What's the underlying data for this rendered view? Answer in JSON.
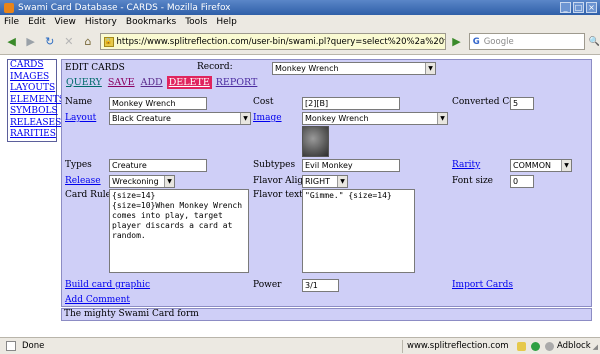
{
  "window": {
    "title": "Swami Card Database - CARDS - Mozilla Firefox",
    "buttons": [
      "_",
      "□",
      "×"
    ]
  },
  "menu": [
    "File",
    "Edit",
    "View",
    "History",
    "Bookmarks",
    "Tools",
    "Help"
  ],
  "nav": {
    "url": "https://www.splitreflection.com/user-bin/swami.pl?query=select%20%2a%20from",
    "search_placeholder": "Google",
    "search_engine_icon": "G"
  },
  "sidebar": {
    "items": [
      "CARDS",
      "IMAGES",
      "LAYOUTS",
      "ELEMENTS",
      "SYMBOLS",
      "RELEASES",
      "RARITIES"
    ]
  },
  "form": {
    "heading": "EDIT CARDS",
    "record_label": "Record:",
    "record_value": "Monkey Wrench",
    "actions": {
      "query": "QUERY",
      "save": "SAVE",
      "add": "ADD",
      "delete": "DELETE",
      "report": "REPORT"
    },
    "name_label": "Name",
    "name_value": "Monkey Wrench",
    "cost_label": "Cost",
    "cost_value": "[2][B]",
    "converted_cost_label": "Converted Cost",
    "converted_cost_value": "5",
    "layout_label": "Layout",
    "layout_value": "Black Creature",
    "image_label": "Image",
    "image_value": "Monkey Wrench",
    "types_label": "Types",
    "types_value": "Creature",
    "subtypes_label": "Subtypes",
    "subtypes_value": "Evil Monkey",
    "rarity_label": "Rarity",
    "rarity_value": "COMMON",
    "release_label": "Release",
    "release_value": "Wreckoning",
    "flavor_align_label": "Flavor Align",
    "flavor_align_value": "RIGHT",
    "font_size_label": "Font size",
    "font_size_value": "0",
    "card_rules_label": "Card Rules",
    "card_rules_value": "{size=14}\n{size=10}When Monkey Wrench comes into play, target player discards a card at random.",
    "flavor_text_label": "Flavor text",
    "flavor_text_value": "\"Gimme.\" {size=14}",
    "build_card_graphic": "Build card graphic",
    "add_comment": "Add Comment",
    "power_label": "Power",
    "power_value": "3/1",
    "import_cards": "Import Cards"
  },
  "footer": "The mighty Swami Card form",
  "status": {
    "text": "Done",
    "domain": "www.splitreflection.com",
    "adblock": "Adblock"
  },
  "colors": {
    "panel_bg": "#cfcff7",
    "delete_bg": "#e0245e",
    "titlebar": "#2f5fa8"
  }
}
